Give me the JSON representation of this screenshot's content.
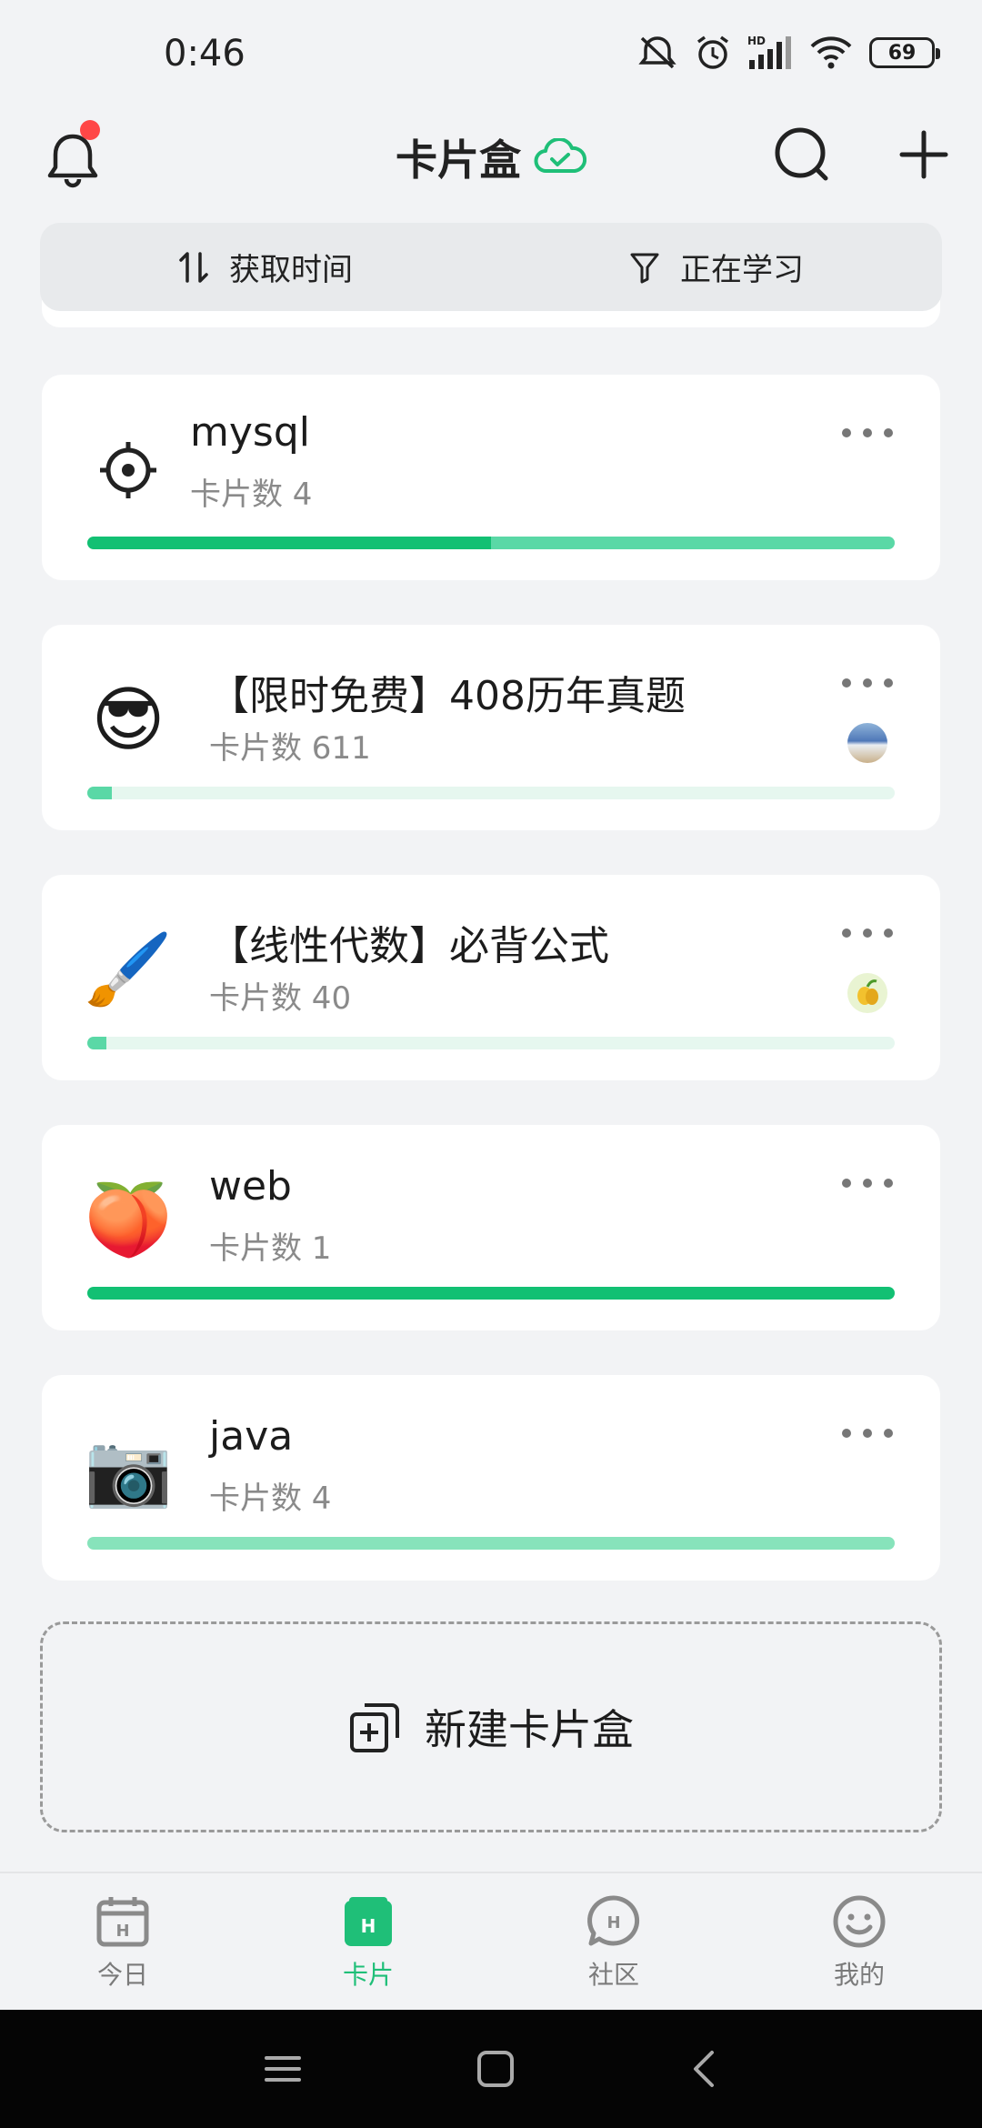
{
  "status_bar": {
    "time": "0:46",
    "battery": "69",
    "icons": [
      "mute-icon",
      "alarm-icon",
      "signal-hd-icon",
      "wifi-icon",
      "battery-icon"
    ]
  },
  "header": {
    "title": "卡片盒",
    "sync_icon": "cloud-check-icon",
    "has_notification_dot": true
  },
  "filter_bar": {
    "sort_label": "获取时间",
    "filter_label": "正在学习"
  },
  "cards": [
    {
      "icon": "gear-icon",
      "title": "mysql",
      "count_label": "卡片数 4",
      "progress": [
        0.5,
        0.5
      ]
    },
    {
      "icon": "😎",
      "title": "【限时免费】408历年真题",
      "count_label": "卡片数 611",
      "avatar": "ocean-avatar",
      "progress": [
        0.03,
        0.0
      ]
    },
    {
      "icon": "🖌️",
      "title": "【线性代数】必背公式",
      "count_label": "卡片数 40",
      "avatar": "lemon-avatar",
      "progress": [
        0.02,
        0.0
      ]
    },
    {
      "icon": "🍑",
      "title": "web",
      "count_label": "卡片数 1",
      "progress": [
        1.0,
        0.0
      ]
    },
    {
      "icon": "📷",
      "title": "java",
      "count_label": "卡片数 4",
      "progress": [
        0.0,
        1.0
      ]
    }
  ],
  "new_box": {
    "label": "新建卡片盒"
  },
  "bottom_nav": {
    "items": [
      {
        "label": "今日",
        "icon": "calendar-icon"
      },
      {
        "label": "卡片",
        "icon": "card-box-icon",
        "active": true
      },
      {
        "label": "社区",
        "icon": "chat-icon"
      },
      {
        "label": "我的",
        "icon": "smile-icon"
      }
    ]
  },
  "colors": {
    "accent": "#1fbf78",
    "progress_dark": "#12c073",
    "progress_mid": "#5ad8a6",
    "progress_light": "#e6f7ef",
    "notification": "#ff4747"
  }
}
